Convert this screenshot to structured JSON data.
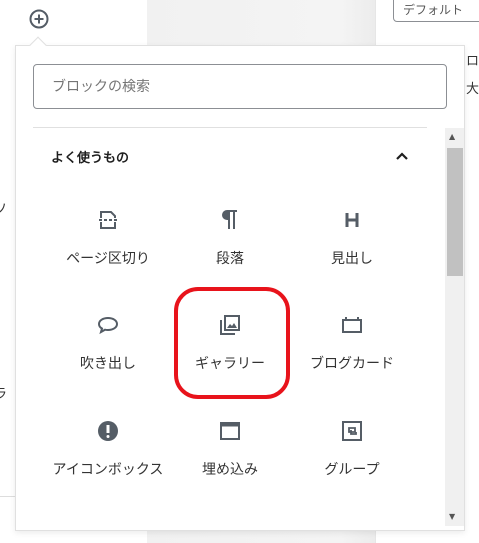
{
  "background": {
    "select_value": "デフォルト",
    "peek_right": [
      "ロ",
      "大"
    ],
    "peek_left": [
      "ソ",
      "ラ"
    ]
  },
  "inserter": {
    "search": {
      "placeholder": "ブロックの検索",
      "value": ""
    },
    "category": {
      "title": "よく使うもの",
      "expanded": true
    },
    "blocks": [
      {
        "label": "ページ区切り",
        "icon": "page-break-icon"
      },
      {
        "label": "段落",
        "icon": "paragraph-icon"
      },
      {
        "label": "見出し",
        "icon": "heading-icon"
      },
      {
        "label": "吹き出し",
        "icon": "speech-bubble-icon"
      },
      {
        "label": "ギャラリー",
        "icon": "gallery-icon",
        "highlighted": true
      },
      {
        "label": "ブログカード",
        "icon": "blog-card-icon"
      },
      {
        "label": "アイコンボックス",
        "icon": "alert-icon"
      },
      {
        "label": "埋め込み",
        "icon": "embed-icon"
      },
      {
        "label": "グループ",
        "icon": "group-icon"
      }
    ]
  },
  "colors": {
    "icon": "#555d66",
    "highlight": "#e8131b"
  }
}
